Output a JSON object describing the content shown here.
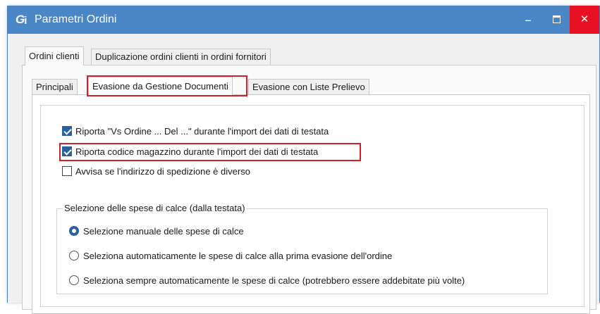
{
  "window": {
    "logo": "G",
    "logo_suffix": "i",
    "title": "Parametri Ordini",
    "controls": {
      "minimize": "‒",
      "close": "✕"
    }
  },
  "outer_tabs": [
    {
      "label": "Ordini clienti",
      "active": true
    },
    {
      "label": "Duplicazione ordini clienti in ordini fornitori",
      "active": false
    }
  ],
  "inner_tabs": [
    {
      "label": "Principali",
      "active": false
    },
    {
      "label": "Evasione da Gestione Documenti",
      "active": true,
      "highlighted": true
    },
    {
      "label": "Evasione con Liste Prelievo",
      "active": false
    }
  ],
  "options": [
    {
      "label": "Riporta \"Vs Ordine ... Del ...\" durante l'import dei dati di testata",
      "checked": true
    },
    {
      "label": "Riporta codice magazzino durante l'import dei dati di testata",
      "checked": true,
      "highlighted": true
    },
    {
      "label": "Avvisa se l'indirizzo di spedizione è diverso",
      "checked": false
    }
  ],
  "spese_group": {
    "legend": "Selezione delle spese di calce (dalla testata)",
    "choices": [
      {
        "label": "Selezione manuale delle spese di calce",
        "selected": true
      },
      {
        "label": "Seleziona automaticamente le spese di calce alla prima evasione dell'ordine",
        "selected": false
      },
      {
        "label": "Seleziona sempre automaticamente le spese di calce (potrebbero essere addebitate più volte)",
        "selected": false
      }
    ]
  },
  "colors": {
    "titlebar": "#4a86c6",
    "close_button": "#e81123",
    "highlight_border": "#d0202a",
    "checkbox_checked": "#2c5f9e"
  }
}
